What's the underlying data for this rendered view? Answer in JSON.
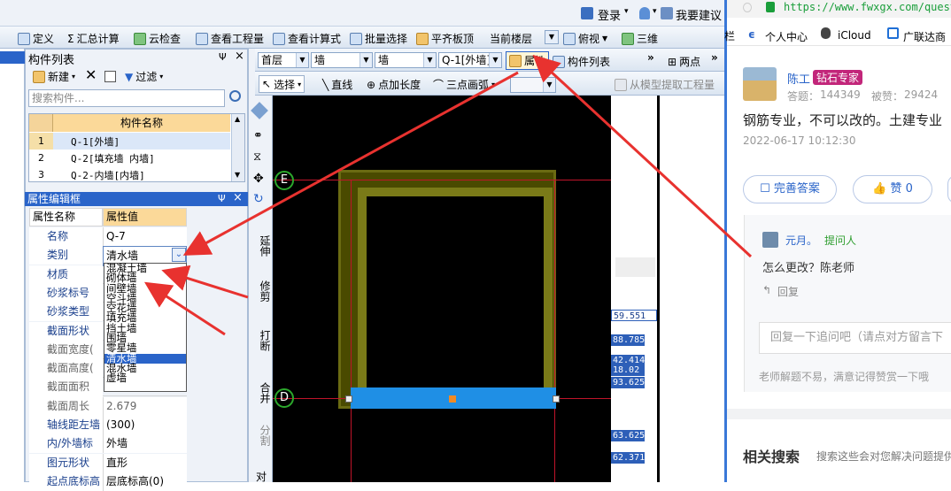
{
  "top_menu": {
    "login": "登录",
    "suggest": "我要建议"
  },
  "toolbar1": {
    "define": "定义",
    "sum_calc": "汇总计算",
    "cloud_check": "云检查",
    "view_quantity": "查看工程量",
    "view_formula": "查看计算式",
    "batch_select": "批量选择",
    "align_slab": "平齐板顶",
    "current_floor": "当前楼层",
    "top_view": "俯视",
    "three_d": "三维"
  },
  "component_list": {
    "title": "构件列表",
    "pin": "Ψ",
    "close": "×",
    "new_label": "新建",
    "filter_label": "过滤",
    "search_placeholder": "搜索构件...",
    "column_header": "构件名称",
    "rows": [
      {
        "num": "1",
        "name": "Q-1[外墙]"
      },
      {
        "num": "2",
        "name": "Q-2[填充墙 内墙]"
      },
      {
        "num": "3",
        "name": "Q-2-内墙[内墙]"
      }
    ]
  },
  "property_box": {
    "title": "属性编辑框",
    "pin": "Ψ",
    "close": "×",
    "col_name": "属性名称",
    "col_value": "属性值",
    "rows": [
      {
        "name": "名称",
        "value": "Q-7"
      },
      {
        "name": "类别",
        "value": "清水墙"
      },
      {
        "name": "材质",
        "value": ""
      },
      {
        "name": "砂浆标号",
        "value": ""
      },
      {
        "name": "砂浆类型",
        "value": ""
      },
      {
        "name": "截面形状",
        "value": ""
      },
      {
        "name": "截面宽度(",
        "value": ""
      },
      {
        "name": "截面高度(",
        "value": ""
      },
      {
        "name": "截面面积(m",
        "value": ""
      },
      {
        "name": "截面周长(m",
        "value": "2.679"
      },
      {
        "name": "轴线距左墙",
        "value": "(300)"
      },
      {
        "name": "内/外墙标",
        "value": "外墙"
      },
      {
        "name": "图元形状",
        "value": "直形"
      },
      {
        "name": "起点底标高",
        "value": "层底标高(0)"
      }
    ],
    "dropdown_options": [
      "混凝土墙",
      "砌体墙",
      "间壁墙",
      "空斗墙",
      "空花墙",
      "填充墙",
      "挡土墙",
      "围墙",
      "零星墙",
      "清水墙",
      "混水墙",
      "虚墙"
    ],
    "dropdown_selected": "清水墙"
  },
  "toolbar2": {
    "floor": "首层",
    "type1": "墙",
    "type2": "墙",
    "component": "Q-1[外墙]",
    "property": "属性",
    "component_list": "构件列表",
    "two_point": "两点",
    "more": "»"
  },
  "toolbar3": {
    "select": "选择",
    "line": "直线",
    "point_length": "点加长度",
    "three_point_arc": "三点画弧",
    "extract_quantity": "从模型提取工程量"
  },
  "vertical_tools": {
    "extend": "延伸",
    "trim": "修剪",
    "break": "打断",
    "merge": "合并",
    "split": "分割",
    "align": "对"
  },
  "axis_labels": {
    "e": "E",
    "d": "D"
  },
  "numbers": [
    "59.551",
    "88.785",
    "42.414",
    "18.02",
    "93.625",
    "63.625",
    "62.371"
  ],
  "browser": {
    "url": "https://www.fwxgx.com/quest",
    "bookmarks": [
      "个人中心",
      "iCloud",
      "广联达商"
    ],
    "sep": "栏"
  },
  "answer": {
    "author": "陈工",
    "badge": "钻石专家",
    "answers_label": "答题：",
    "answers": "144349",
    "likes_label": "被赞：",
    "likes": "29424",
    "text": "钢筋专业，不可以改的。土建专业",
    "time": "2022-06-17 10:12:30",
    "improve": "完善答案",
    "like": "赞 0"
  },
  "followup": {
    "user": "元月。",
    "role": "提问人",
    "question": "怎么更改？陈老师",
    "reply": "回复",
    "reply_placeholder": "回复一下追问吧（请点对方留言下",
    "note": "老师解题不易，满意记得赞赏一下哦"
  },
  "related": {
    "title": "相关搜索",
    "subtitle": "搜索这些会对您解决问题提供"
  },
  "colors": {
    "accent": "#2a64c9",
    "badge": "#c2267a",
    "blue_bar": "#1f8fe5",
    "arrow": "#e8322f"
  }
}
